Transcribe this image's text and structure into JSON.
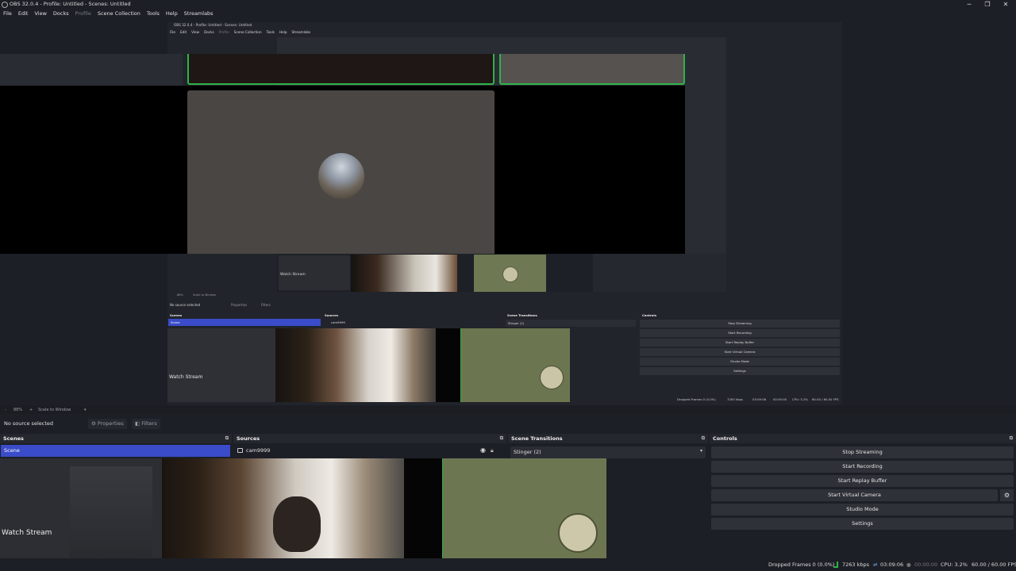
{
  "window": {
    "title": "OBS 32.0.4 - Profile: Untitled - Scenes: Untitled",
    "minimize": "─",
    "restore": "❐",
    "close": "✕"
  },
  "menu": [
    "File",
    "Edit",
    "View",
    "Docks",
    "Profile",
    "Scene Collection",
    "Tools",
    "Help",
    "Streamlabs"
  ],
  "nested": {
    "title": "OBS 32.0.4 - Profile: Untitled - Scenes: Untitled",
    "menu": [
      "File",
      "Edit",
      "View",
      "Docks",
      "Profile",
      "Scene Collection",
      "Tools",
      "Help",
      "Streamlabs"
    ],
    "watch_stream": "Watch Stream",
    "zoom": "88%",
    "scale_mode": "Scale to Window",
    "no_source": "No source selected",
    "properties": "Properties",
    "filters": "Filters",
    "docks": {
      "scenes": "Scenes",
      "sources": "Sources",
      "transitions": "Scene Transitions",
      "controls": "Controls"
    },
    "scene": "Scene",
    "source": "cam9999",
    "transition": "Stinger (2)",
    "controls": [
      "Stop Streaming",
      "Start Recording",
      "Start Replay Buffer",
      "Start Virtual Camera",
      "Studio Mode",
      "Settings"
    ],
    "status": {
      "dropped": "Dropped Frames 0 (0.0%)",
      "kbps": "7263 kbps",
      "time1": "03:09:06",
      "time2": "00:00:00",
      "cpu": "CPU: 3.2%",
      "fps": "60.00 / 60.00 FPS"
    }
  },
  "zoombar": {
    "zoom_minus": "-",
    "zoom": "88%",
    "zoom_plus": "+",
    "scale_mode": "Scale to Window",
    "caret": "▾"
  },
  "source_bar": {
    "no_source": "No source selected",
    "properties": "Properties",
    "filters": "Filters"
  },
  "docks": {
    "scenes": {
      "title": "Scenes",
      "selected": "Scene"
    },
    "sources": {
      "title": "Sources",
      "item": "cam9999"
    },
    "transitions": {
      "title": "Scene Transitions",
      "selected": "Stinger (2)"
    },
    "controls": {
      "title": "Controls",
      "buttons": [
        "Stop Streaming",
        "Start Recording",
        "Start Replay Buffer",
        "Start Virtual Camera",
        "Studio Mode",
        "Settings"
      ]
    }
  },
  "overlay": {
    "watch_stream": "Watch Stream"
  },
  "status": {
    "dropped": "Dropped Frames 0 (0.0%)",
    "kbps": "7263 kbps",
    "stream_time": "03:09:06",
    "rec_time": "00:00:00",
    "cpu": "CPU: 3.2%",
    "fps": "60.00 / 60.00 FPS"
  },
  "colors": {
    "accent": "#3a4cc9",
    "live_green": "#2fb34a",
    "panel": "#1d1f26"
  }
}
